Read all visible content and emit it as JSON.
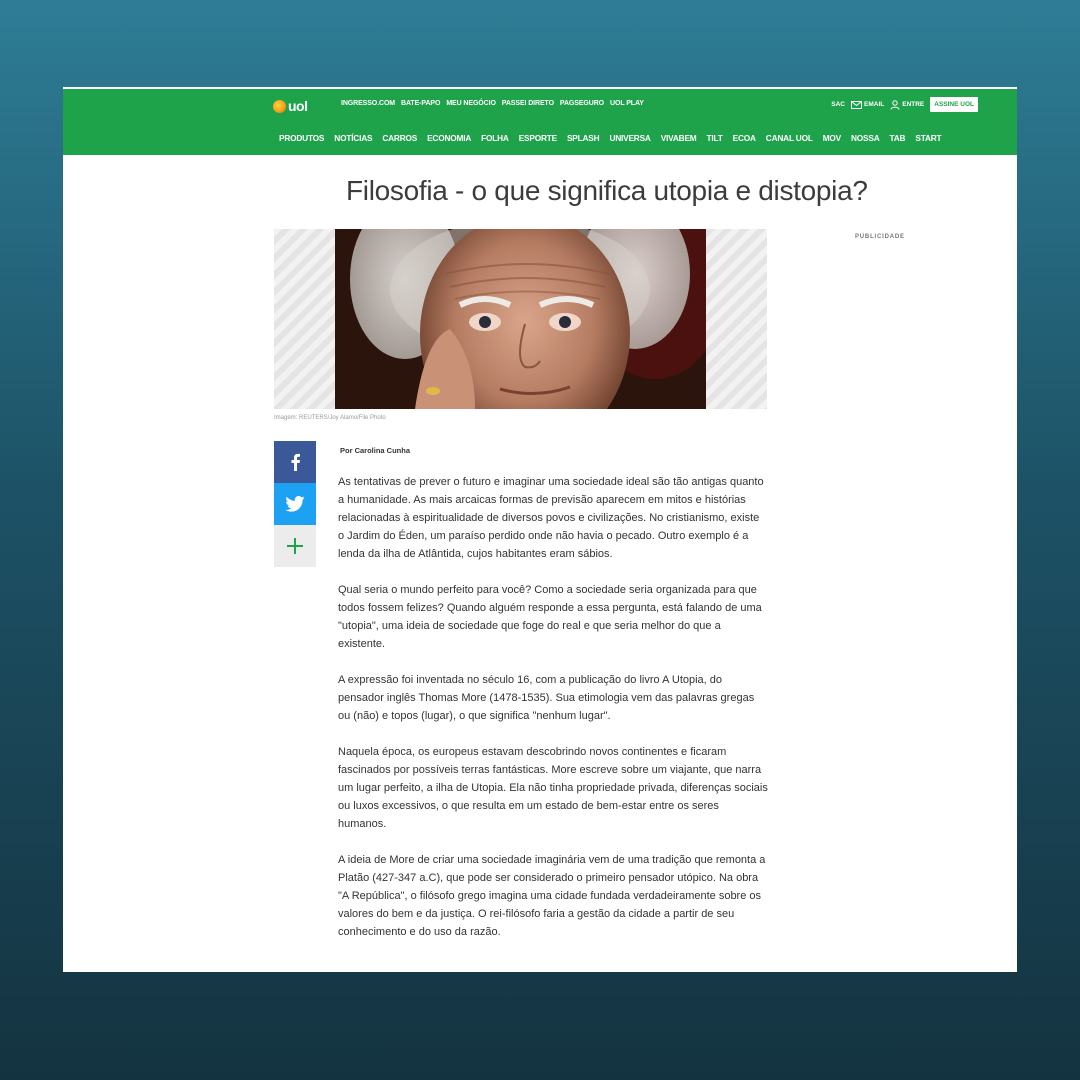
{
  "brand": {
    "logo_text": "uol"
  },
  "topbar": {
    "links": [
      "INGRESSO.COM",
      "BATE-PAPO",
      "MEU NEGÓCIO",
      "PASSEI DIRETO",
      "PAGSEGURO",
      "UOL PLAY"
    ],
    "sac_label": "SAC",
    "email_label": "EMAIL",
    "entre_label": "ENTRE",
    "assine_label": "ASSINE UOL",
    "accent_color": "#1ea34a"
  },
  "nav": {
    "items": [
      "PRODUTOS",
      "NOTÍCIAS",
      "CARROS",
      "ECONOMIA",
      "FOLHA",
      "ESPORTE",
      "SPLASH",
      "UNIVERSA",
      "VIVABEM",
      "TILT",
      "ECOA",
      "CANAL UOL",
      "MOV",
      "NOSSA",
      "TAB",
      "START"
    ]
  },
  "article": {
    "title": "Filosofia - o que significa utopia e distopia?",
    "image_caption": "Imagem: REUTERS/Joy Alamo/File Photo",
    "ad_label": "PUBLICIDADE",
    "author": "Por Carolina Cunha",
    "paragraphs": [
      "As tentativas de prever o futuro e imaginar uma sociedade ideal são tão antigas quanto a humanidade. As mais arcaicas formas de previsão aparecem em mitos e histórias relacionadas à espiritualidade de diversos povos e civilizações. No cristianismo, existe o Jardim do Éden, um paraíso perdido onde não havia o pecado. Outro exemplo é a lenda da ilha de Atlântida, cujos habitantes eram sábios.",
      "Qual seria o mundo perfeito para você? Como a sociedade seria organizada para que todos fossem felizes? Quando alguém responde a essa pergunta, está falando de uma \"utopia\", uma ideia de sociedade que foge do real e que seria melhor do que a existente.",
      "A expressão foi inventada no século 16, com a publicação do livro A Utopia, do pensador inglês Thomas More (1478-1535). Sua etimologia vem das palavras gregas ou (não) e topos (lugar), o que significa \"nenhum lugar\".",
      "Naquela época, os europeus estavam descobrindo novos continentes e ficaram fascinados por possíveis terras fantásticas. More escreve sobre um viajante, que narra um lugar perfeito, a ilha de Utopia. Ela não tinha propriedade privada, diferenças sociais ou luxos excessivos, o que resulta em um estado de bem-estar entre os seres humanos.",
      "A ideia de More de criar uma sociedade imaginária vem de uma tradição que remonta a Platão (427-347 a.C), que pode ser considerado o primeiro pensador utópico. Na obra \"A República\", o filósofo grego imagina uma cidade fundada verdadeiramente sobre os valores do bem e da justiça. O rei-filósofo faria a gestão da cidade a partir de seu conhecimento e do uso da razão."
    ]
  },
  "share": {
    "icons": [
      "facebook-icon",
      "twitter-icon",
      "plus-icon"
    ],
    "facebook_color": "#3b5998",
    "twitter_color": "#1da1f2"
  }
}
